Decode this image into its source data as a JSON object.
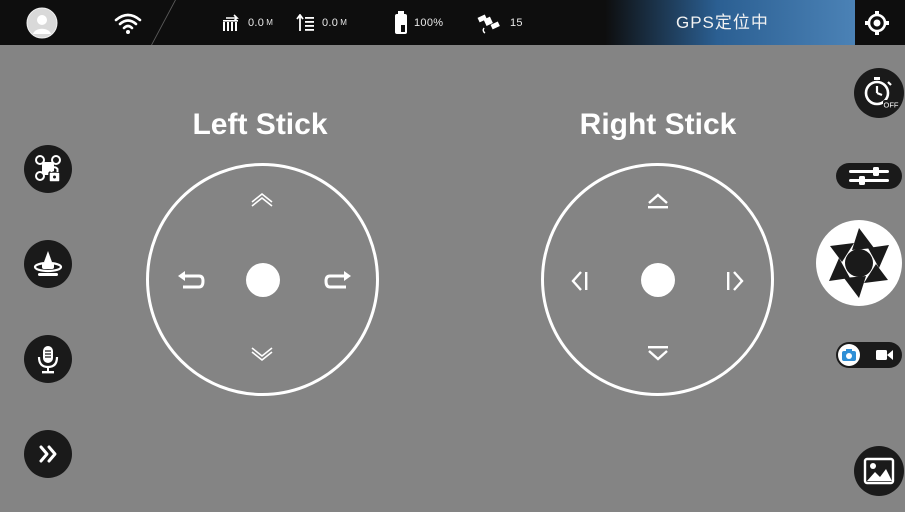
{
  "statusbar": {
    "distance": {
      "value": "0.0",
      "unit": "M"
    },
    "height": {
      "value": "0.0",
      "unit": "M"
    },
    "battery": "100%",
    "satellites": "15",
    "gps_status": "GPS定位中"
  },
  "sticks": {
    "left": {
      "label": "Left Stick"
    },
    "right": {
      "label": "Right Stick"
    }
  },
  "icons": {
    "avatar": "avatar-icon",
    "wifi": "wifi-icon",
    "distance": "distance-icon",
    "height": "height-icon",
    "battery": "battery-icon",
    "satellite": "satellite-icon",
    "settings": "gear-icon",
    "timer": "timer-off-icon",
    "sliders": "sliders-icon",
    "shutter": "shutter-icon",
    "photo": "camera-icon",
    "video": "video-icon",
    "gallery": "gallery-icon",
    "lock": "drone-lock-icon",
    "takeoff": "takeoff-icon",
    "voice": "microphone-icon",
    "more": "chevron-right-icon"
  },
  "colors": {
    "background": "#848484",
    "topbar": "#0e0e0e",
    "gps_band": "#4b82b6",
    "photo_active": "#2f8fd6"
  }
}
